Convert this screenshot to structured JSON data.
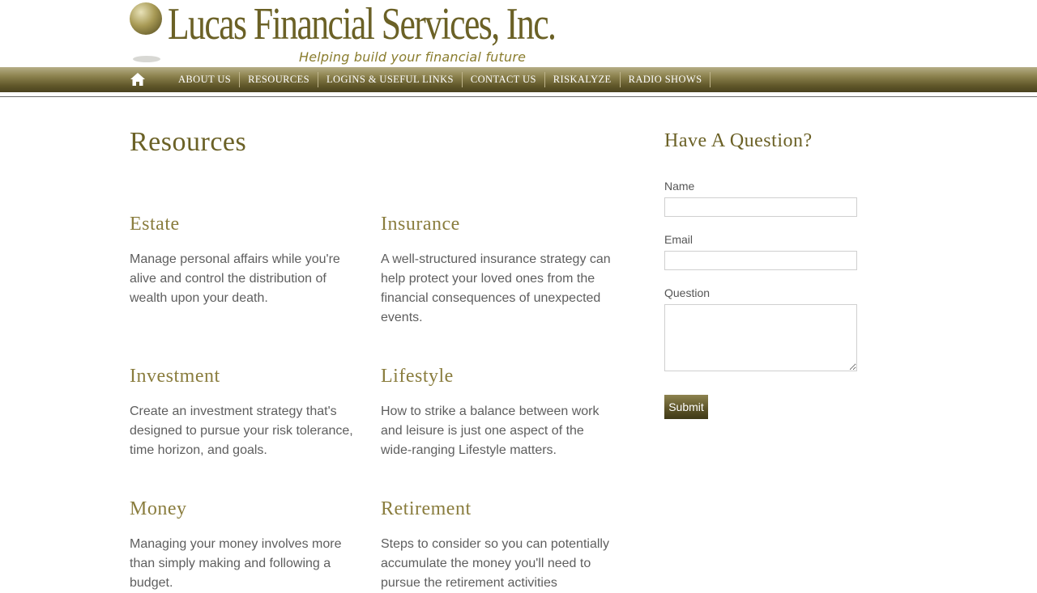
{
  "header": {
    "logo_title": "Lucas Financial Services, Inc.",
    "logo_tagline": "Helping build your financial future",
    "brand_color": "#6b6126"
  },
  "nav": {
    "home_icon": "home-icon",
    "items": [
      {
        "label": "About Us"
      },
      {
        "label": "Resources"
      },
      {
        "label": "Logins & Useful Links"
      },
      {
        "label": "Contact Us"
      },
      {
        "label": "Riskalyze"
      },
      {
        "label": "Radio Shows"
      }
    ]
  },
  "main": {
    "title": "Resources",
    "sections": [
      {
        "title": "Estate",
        "text": "Manage personal affairs while you're alive and control the distribution of wealth upon your death."
      },
      {
        "title": "Insurance",
        "text": "A well-structured insurance strategy can help protect your loved ones from the financial consequences of unexpected events."
      },
      {
        "title": "Investment",
        "text": "Create an investment strategy that's designed to pursue your risk tolerance, time horizon, and goals."
      },
      {
        "title": "Lifestyle",
        "text": "How to strike a balance between work and leisure is just one aspect of the wide-ranging Lifestyle matters."
      },
      {
        "title": "Money",
        "text": "Managing your money involves more than simply making and following a budget."
      },
      {
        "title": "Retirement",
        "text": "Steps to consider so you can potentially accumulate the money you'll need to pursue the retirement activities"
      }
    ]
  },
  "sidebar": {
    "title": "Have A Question?",
    "name_label": "Name",
    "name_value": "",
    "email_label": "Email",
    "email_value": "",
    "question_label": "Question",
    "question_value": "",
    "submit_label": "Submit"
  }
}
